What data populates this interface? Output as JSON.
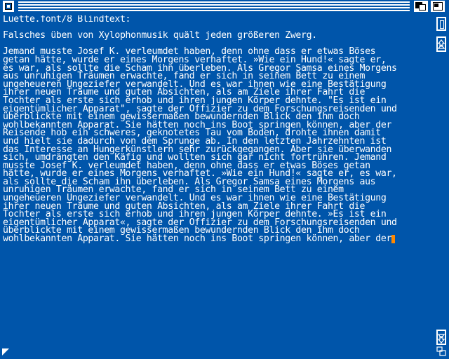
{
  "editor": {
    "lines": [
      "Luette.font/8 Blindtext:",
      "",
      "Falsches üben von Xylophonmusik quält jeden größeren Zwerg.",
      "",
      "Jemand musste Josef K. verleumdet haben, denn ohne dass er etwas Böses",
      "getan hätte, wurde er eines Morgens verhaftet. »Wie ein Hund!« sagte er,",
      "es war, als sollte die Scham ihn überleben. Als Gregor Samsa eines Morgens",
      "aus unruhigen Träumen erwachte, fand er sich in seinem Bett zu einem",
      "ungeheueren Ungeziefer verwandelt. Und es war ihnen wie eine Bestätigung",
      "ihrer neuen Träume und guten Absichten, als am Ziele ihrer Fahrt die",
      "Tochter als erste sich erhob und ihren jungen Körper dehnte. \"Es ist ein",
      "eigentümlicher Apparat\", sagte der Offizier zu dem Forschungsreisenden und",
      "überblickte mit einem gewissermaßen bewundernden Blick den ihm doch",
      "wohlbekannten Apparat. Sie hätten noch ins Boot springen können, aber der",
      "Reisende hob ein schweres, geknotetes Tau vom Boden, drohte ihnen damit",
      "und hielt sie dadurch von dem Sprunge ab. In den letzten Jahrzehnten ist",
      "das Interesse an Hungerkünstlern sehr zurückgegangen. Aber sie überwanden",
      "sich, umdrängten den Käfig und wollten sich gar nicht fortrühren. Jemand",
      "musste Josef K. verleumdet haben, denn ohne dass er etwas Böses getan",
      "hätte, wurde er eines Morgens verhaftet. »Wie ein Hund!« sagte er, es war,",
      "als sollte die Scham ihn überleben. Als Gregor Samsa eines Morgens aus",
      "unruhigen Träumen erwachte, fand er sich in seinem Bett zu einem",
      "ungeheueren Ungeziefer verwandelt. Und es war ihnen wie eine Bestätigung",
      "ihrer neuen Träume und guten Absichten, als am Ziele ihrer Fahrt die",
      "Tochter als erste sich erhob und ihren jungen Körper dehnte. »Es ist ein",
      "eigentümlicher Apparat«, sagte der Offizier zu dem Forschungsreisenden und",
      "überblickte mit einem gewissermaßen bewundernden Blick den ihm doch",
      "wohlbekannten Apparat. Sie hätten noch ins Boot springen können, aber der"
    ]
  },
  "scrollbar": {
    "indicator": "0"
  },
  "colors": {
    "background": "#0055aa",
    "text": "#ffffff",
    "cursor": "#ff8800"
  },
  "icons": [
    "close-icon",
    "depth-icon",
    "zoom-icon",
    "arrow-up-icon",
    "arrow-down-icon",
    "resize-icon",
    "size-icon"
  ]
}
